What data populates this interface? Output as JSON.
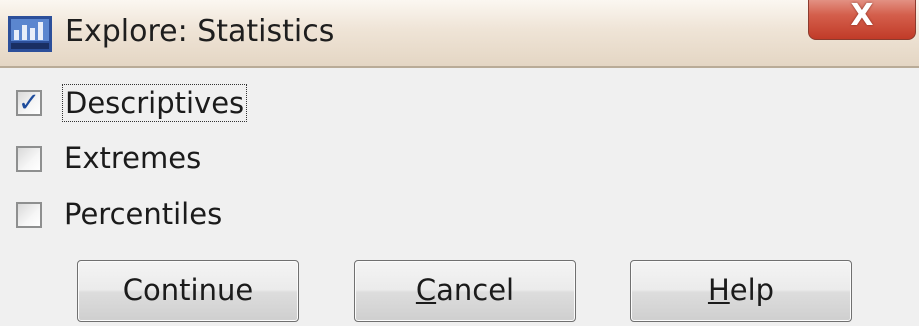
{
  "window": {
    "title": "Explore: Statistics",
    "app_icon": "spss-app-icon",
    "close_glyph": "X"
  },
  "options": [
    {
      "label": "Descriptives",
      "checked": true,
      "focused": true
    },
    {
      "label": "Extremes",
      "checked": false,
      "focused": false
    },
    {
      "label": "Percentiles",
      "checked": false,
      "focused": false
    }
  ],
  "buttons": {
    "continue_label": "Continue",
    "cancel_mnemonic": "C",
    "cancel_rest": "ancel",
    "help_mnemonic": "H",
    "help_rest": "elp"
  },
  "colors": {
    "titlebar": "#efe4d6",
    "close_button": "#d45f4c",
    "checkmark": "#1e4c9c",
    "dialog_background": "#f0f0f0"
  }
}
